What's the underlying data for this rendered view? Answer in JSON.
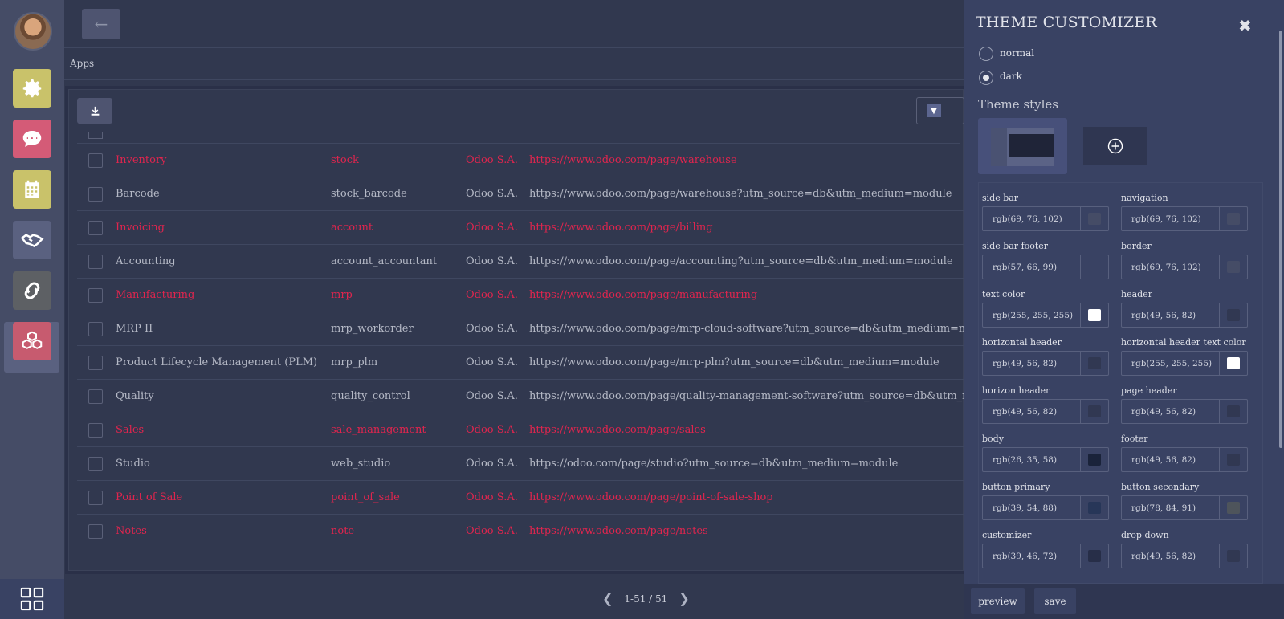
{
  "breadcrumb": "Apps",
  "apps_table": {
    "rows": [
      {
        "name": "Inventory",
        "technical": "stock",
        "author": "Odoo S.A.",
        "url": "https://www.odoo.com/page/warehouse",
        "style": "red"
      },
      {
        "name": "Barcode",
        "technical": "stock_barcode",
        "author": "Odoo S.A.",
        "url": "https://www.odoo.com/page/warehouse?utm_source=db&utm_medium=module",
        "style": "grey"
      },
      {
        "name": "Invoicing",
        "technical": "account",
        "author": "Odoo S.A.",
        "url": "https://www.odoo.com/page/billing",
        "style": "red"
      },
      {
        "name": "Accounting",
        "technical": "account_accountant",
        "author": "Odoo S.A.",
        "url": "https://www.odoo.com/page/accounting?utm_source=db&utm_medium=module",
        "style": "grey"
      },
      {
        "name": "Manufacturing",
        "technical": "mrp",
        "author": "Odoo S.A.",
        "url": "https://www.odoo.com/page/manufacturing",
        "style": "red"
      },
      {
        "name": "MRP II",
        "technical": "mrp_workorder",
        "author": "Odoo S.A.",
        "url": "https://www.odoo.com/page/mrp-cloud-software?utm_source=db&utm_medium=module",
        "style": "grey"
      },
      {
        "name": "Product Lifecycle Management (PLM)",
        "technical": "mrp_plm",
        "author": "Odoo S.A.",
        "url": "https://www.odoo.com/page/mrp-plm?utm_source=db&utm_medium=module",
        "style": "grey"
      },
      {
        "name": "Quality",
        "technical": "quality_control",
        "author": "Odoo S.A.",
        "url": "https://www.odoo.com/page/quality-management-software?utm_source=db&utm_medium=m",
        "style": "grey"
      },
      {
        "name": "Sales",
        "technical": "sale_management",
        "author": "Odoo S.A.",
        "url": "https://www.odoo.com/page/sales",
        "style": "red"
      },
      {
        "name": "Studio",
        "technical": "web_studio",
        "author": "Odoo S.A.",
        "url": "https://odoo.com/page/studio?utm_source=db&utm_medium=module",
        "style": "grey"
      },
      {
        "name": "Point of Sale",
        "technical": "point_of_sale",
        "author": "Odoo S.A.",
        "url": "https://www.odoo.com/page/point-of-sale-shop",
        "style": "red"
      },
      {
        "name": "Notes",
        "technical": "note",
        "author": "Odoo S.A.",
        "url": "https://www.odoo.com/page/notes",
        "style": "red"
      }
    ]
  },
  "pager": {
    "range": "1-51 / 51"
  },
  "sidebar_apps": [
    {
      "icon": "gear-icon",
      "color": "#c9c26a"
    },
    {
      "icon": "chat-icon",
      "color": "#d45b77"
    },
    {
      "icon": "calendar-icon",
      "color": "#c9c26a"
    },
    {
      "icon": "handshake-icon",
      "color": "#5a6180"
    },
    {
      "icon": "link-icon",
      "color": "#5d6064"
    },
    {
      "icon": "cubes-icon",
      "color": "#c75b6f"
    }
  ],
  "customizer": {
    "title": "THEME CUSTOMIZER",
    "modes": [
      {
        "label": "normal",
        "checked": false
      },
      {
        "label": "dark",
        "checked": true
      }
    ],
    "styles_title": "Theme styles",
    "fields": [
      {
        "label": "side bar",
        "value": "rgb(69, 76, 102)",
        "swatch": "#454c66"
      },
      {
        "label": "navigation",
        "value": "rgb(69, 76, 102)",
        "swatch": "#454c66"
      },
      {
        "label": "side bar footer",
        "value": "rgb(57, 66, 99)",
        "swatch": "#394263"
      },
      {
        "label": "border",
        "value": "rgb(69, 76, 102)",
        "swatch": "#454c66"
      },
      {
        "label": "text color",
        "value": "rgb(255, 255, 255)",
        "swatch": "#ffffff"
      },
      {
        "label": "header",
        "value": "rgb(49, 56, 82)",
        "swatch": "#313852"
      },
      {
        "label": "horizontal header",
        "value": "rgb(49, 56, 82)",
        "swatch": "#313852"
      },
      {
        "label": "horizontal header text color",
        "value": "rgb(255, 255, 255)",
        "swatch": "#ffffff"
      },
      {
        "label": "horizon header",
        "value": "rgb(49, 56, 82)",
        "swatch": "#313852"
      },
      {
        "label": "page header",
        "value": "rgb(49, 56, 82)",
        "swatch": "#313852"
      },
      {
        "label": "body",
        "value": "rgb(26, 35, 58)",
        "swatch": "#1a233a"
      },
      {
        "label": "footer",
        "value": "rgb(49, 56, 82)",
        "swatch": "#313852"
      },
      {
        "label": "button primary",
        "value": "rgb(39, 54, 88)",
        "swatch": "#273658"
      },
      {
        "label": "button secondary",
        "value": "rgb(78, 84, 91)",
        "swatch": "#4e545b"
      },
      {
        "label": "customizer",
        "value": "rgb(39, 46, 72)",
        "swatch": "#272e48"
      },
      {
        "label": "drop down",
        "value": "rgb(49, 56, 82)",
        "swatch": "#313852"
      }
    ],
    "preview_label": "preview",
    "save_label": "save"
  }
}
